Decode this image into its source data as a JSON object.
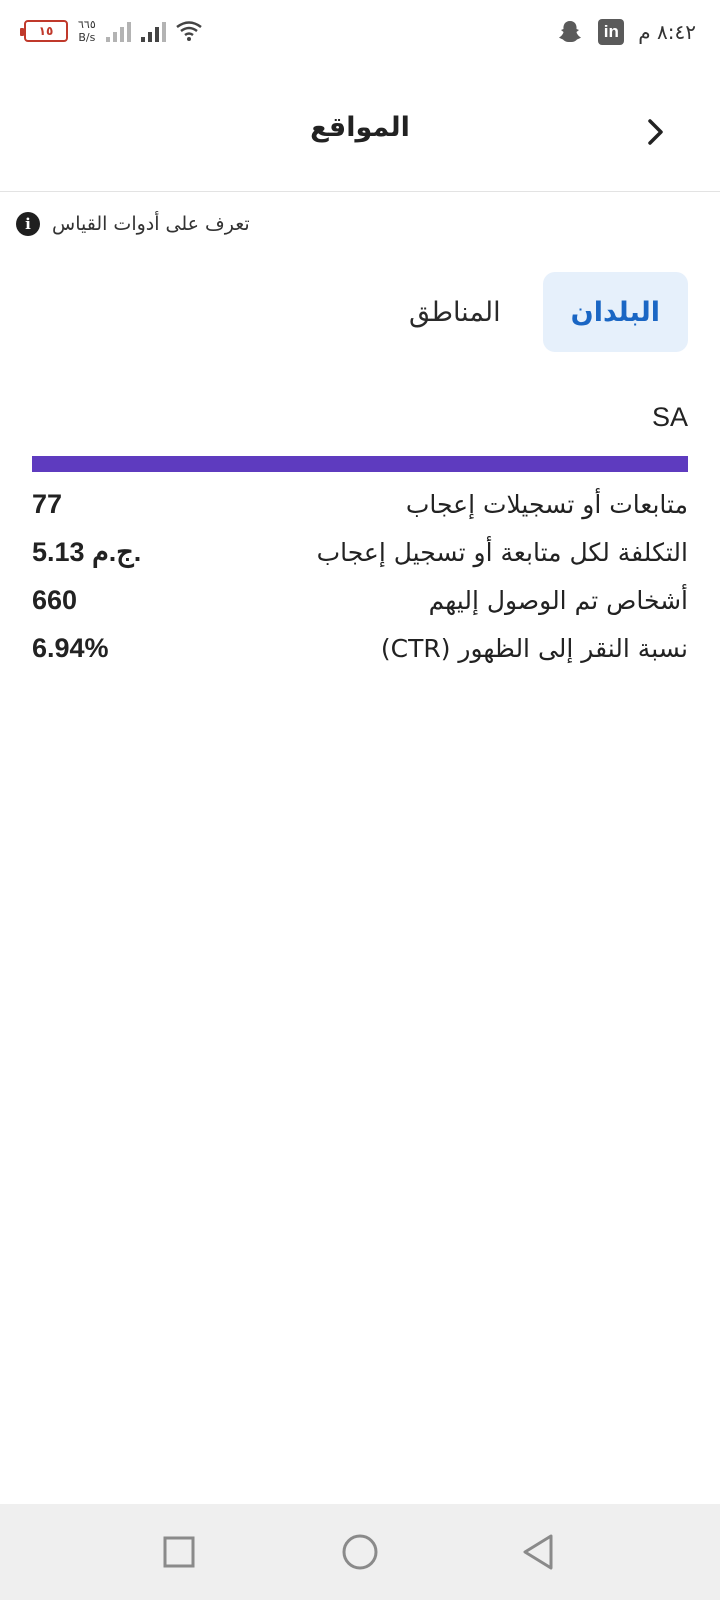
{
  "status_bar": {
    "battery_level": "١٥",
    "net_speed_value": "٦٦٥",
    "net_speed_unit": "B/s",
    "time": "٨:٤٢ م",
    "linkedin_label": "in"
  },
  "header": {
    "title": "المواقع"
  },
  "info": {
    "text": "تعرف على أدوات القياس",
    "icon_glyph": "i"
  },
  "tabs": [
    {
      "label": "البلدان",
      "active": true
    },
    {
      "label": "المناطق",
      "active": false
    }
  ],
  "country": {
    "code": "SA",
    "bar_fraction": 1.0,
    "bar_color": "#5e3bbf"
  },
  "metrics": [
    {
      "label": "متابعات أو تسجيلات إعجاب",
      "value": "77"
    },
    {
      "label": "التكلفة لكل متابعة أو تسجيل إعجاب",
      "value": "5.13 ج.م."
    },
    {
      "label": "أشخاص تم الوصول إليهم",
      "value": "660"
    },
    {
      "label": "نسبة النقر إلى الظهور (CTR)",
      "value": "6.94%"
    }
  ],
  "colors": {
    "accent": "#1a66c4",
    "active_tab_bg": "#e6f0fb",
    "bar": "#5e3bbf"
  }
}
